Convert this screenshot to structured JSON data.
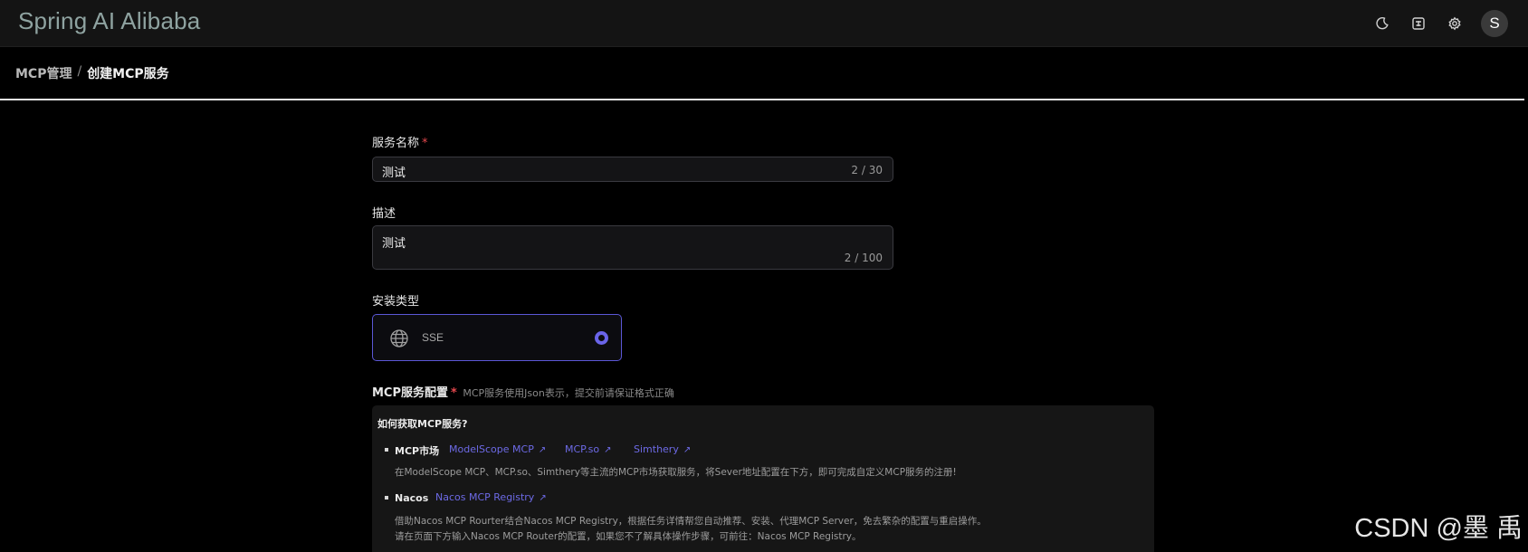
{
  "app": {
    "title": "Spring AI Alibaba",
    "avatar_initial": "S"
  },
  "header": {
    "icons": [
      "moon-icon",
      "translate-icon",
      "gear-icon"
    ]
  },
  "breadcrumb": {
    "parent": "MCP管理",
    "separator": "/",
    "current": "创建MCP服务"
  },
  "form": {
    "name": {
      "label": "服务名称",
      "required_mark": "*",
      "value": "测试",
      "count": "2 / 30"
    },
    "description": {
      "label": "描述",
      "value": "测试",
      "count": "2 / 100"
    },
    "install_type": {
      "label": "安装类型",
      "option": "SSE",
      "icon": "globe-icon",
      "selected": true
    },
    "config": {
      "label": "MCP服务配置",
      "required_mark": "*",
      "hint": "MCP服务使用Json表示，提交前请保证格式正确"
    }
  },
  "panel": {
    "title": "如何获取MCP服务?",
    "items": [
      {
        "title": "MCP市场",
        "links": [
          "ModelScope MCP",
          "MCP.so",
          "Simthery"
        ],
        "desc": [
          "在ModelScope MCP、MCP.so、Simthery等主流的MCP市场获取服务，将Sever地址配置在下方，即可完成自定义MCP服务的注册!"
        ]
      },
      {
        "title": "Nacos",
        "links": [
          "Nacos MCP Registry"
        ],
        "desc": [
          "借助Nacos MCP Rourter结合Nacos MCP Registry，根据任务详情帮您自动推荐、安装、代理MCP Server，免去繁杂的配置与重启操作。",
          "请在页面下方输入Nacos MCP Router的配置，如果您不了解具体操作步骤，可前往：Nacos MCP Registry。"
        ]
      }
    ]
  },
  "watermark": "CSDN @墨 禹",
  "colors": {
    "accent": "#6a64e8",
    "link": "#6d6ae6",
    "required": "#e5484d",
    "background": "#000000"
  }
}
